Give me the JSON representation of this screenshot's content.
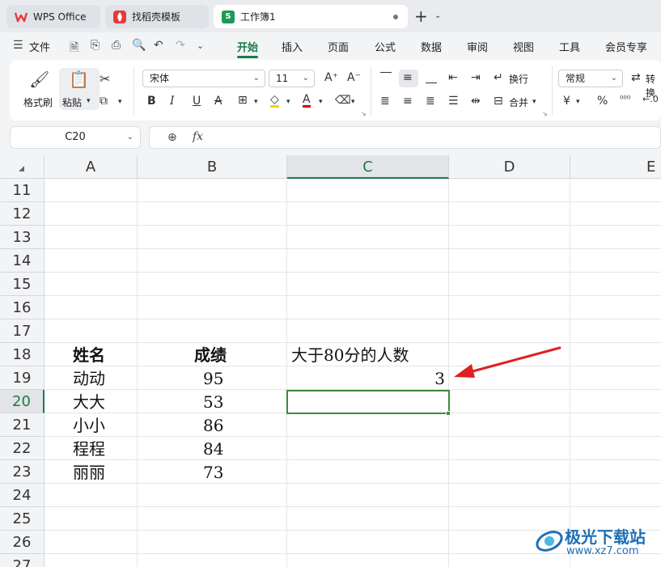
{
  "tabs": [
    {
      "label": "WPS Office",
      "icon": "wps-logo-icon"
    },
    {
      "label": "找稻壳模板",
      "icon": "docer-icon"
    },
    {
      "label": "工作簿1",
      "icon": "spreadsheet-icon",
      "icon_letter": "S"
    }
  ],
  "menu": [
    "文件",
    "开始",
    "插入",
    "页面",
    "公式",
    "数据",
    "审阅",
    "视图",
    "工具",
    "会员专享"
  ],
  "ribbon": {
    "format_painter": "格式刷",
    "paste": "粘贴",
    "font_name": "宋体",
    "font_size": "11",
    "wrap": "换行",
    "merge": "合并",
    "number_format": "常规",
    "convert": "转换"
  },
  "formula_bar": {
    "cell_ref": "C20",
    "formula": ""
  },
  "columns": [
    "A",
    "B",
    "C",
    "D",
    "E"
  ],
  "rows": [
    "11",
    "12",
    "13",
    "14",
    "15",
    "16",
    "17",
    "18",
    "19",
    "20",
    "21",
    "22",
    "23",
    "24",
    "25",
    "26",
    "27"
  ],
  "selected": {
    "column": "C",
    "row": "20"
  },
  "cells": {
    "a18": "姓名",
    "b18": "成绩",
    "c18": "大于80分的人数",
    "a19": "动动",
    "b19": "95",
    "c19": "3",
    "a20": "大大",
    "b20": "53",
    "a21": "小小",
    "b21": "86",
    "a22": "程程",
    "b22": "84",
    "a23": "丽丽",
    "b23": "73"
  },
  "annotation": {
    "arrow_color": "#e02020"
  },
  "watermark": {
    "name": "极光下载站",
    "url": "www.xz7.com"
  },
  "colors": {
    "accent": "#1d7a4a",
    "selection_border": "#3e8a3e",
    "wps_red": "#e6393b"
  }
}
